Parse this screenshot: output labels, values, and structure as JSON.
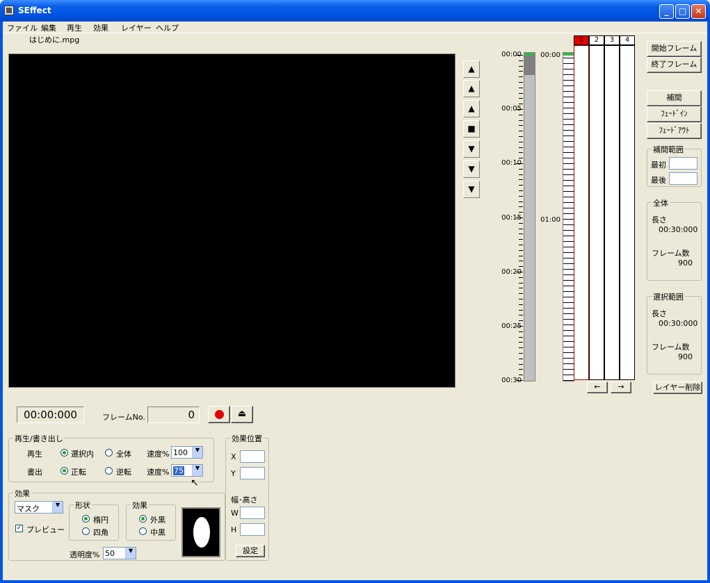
{
  "window": {
    "title": "SEffect"
  },
  "menu": [
    "ファイル",
    "編集",
    "再生",
    "効果",
    "レイヤー",
    "ヘルプ"
  ],
  "file": {
    "name": "はじめに.mpg"
  },
  "nav": {
    "buttons": [
      "▲",
      "▲",
      "▲",
      "■",
      "▼",
      "▼",
      "▼"
    ]
  },
  "scale": {
    "labels": [
      "00:00",
      "00:05",
      "00:10",
      "00:15",
      "00:20",
      "00:25",
      "00:30"
    ]
  },
  "timeline": {
    "labels": [
      "00:00",
      "01:00"
    ]
  },
  "layers": {
    "headers": [
      "1",
      "2",
      "3",
      "4"
    ],
    "active": "1"
  },
  "layer_nav": {
    "left": "←",
    "right": "→"
  },
  "right": {
    "start_frame": "開始フレーム",
    "end_frame": "終了フレーム",
    "interp": "補間",
    "fade_in": "ﾌｪｰﾄﾞｲﾝ",
    "fade_out": "ﾌｪｰﾄﾞｱｳﾄ",
    "interp_range": {
      "title": "補間範囲",
      "first": "最初",
      "last": "最後"
    },
    "total": {
      "title": "全体",
      "length_label": "長さ",
      "length": "00:30:000",
      "frames_label": "フレーム数",
      "frames": "900"
    },
    "selection": {
      "title": "選択範囲",
      "length_label": "長さ",
      "length": "00:30:000",
      "frames_label": "フレーム数",
      "frames": "900"
    },
    "delete_layer": "レイヤー削除"
  },
  "transport": {
    "time": "00:00:000",
    "frame_label": "フレームNo.",
    "frame": "0"
  },
  "playback": {
    "title": "再生/書き出し",
    "play_label": "再生",
    "play_opt1": "選択内",
    "play_opt2": "全体",
    "speed_label": "速度%",
    "play_speed": "100",
    "write_label": "書出",
    "write_opt1": "正転",
    "write_opt2": "逆転",
    "write_speed": "75"
  },
  "effect": {
    "title": "効果",
    "type": "マスク",
    "preview": "プレビュー",
    "shape_title": "形状",
    "shape1": "楕円",
    "shape2": "四角",
    "effect_title": "効果",
    "effect1": "外黒",
    "effect2": "中黒",
    "opacity_label": "透明度%",
    "opacity": "50"
  },
  "position": {
    "title": "効果位置",
    "x": "X",
    "y": "Y",
    "size_title": "幅･高さ",
    "w": "W",
    "h": "H",
    "set": "設定"
  }
}
